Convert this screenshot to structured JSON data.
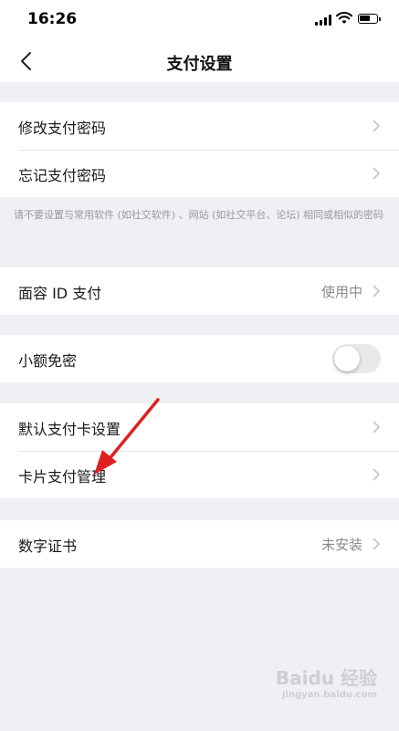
{
  "status_bar": {
    "time": "16:26"
  },
  "nav": {
    "title": "支付设置"
  },
  "groups": {
    "password": [
      {
        "label": "修改支付密码"
      },
      {
        "label": "忘记支付密码"
      }
    ],
    "note": "请不要设置与常用软件 (如社交软件) 、网站 (如社交平台、论坛) 相同或相似的密码",
    "faceid": {
      "label": "面容 ID 支付",
      "value": "使用中"
    },
    "small": {
      "label": "小额免密",
      "toggle_on": false
    },
    "card": [
      {
        "label": "默认支付卡设置"
      },
      {
        "label": "卡片支付管理"
      }
    ],
    "cert": {
      "label": "数字证书",
      "value": "未安装"
    }
  },
  "watermark": {
    "text": "Baidu 经验",
    "sub": "jingyan.baidu.com"
  },
  "colors": {
    "background": "#efeff4",
    "arrow": "#e02020",
    "toggle_off": "#e9e9ea"
  }
}
